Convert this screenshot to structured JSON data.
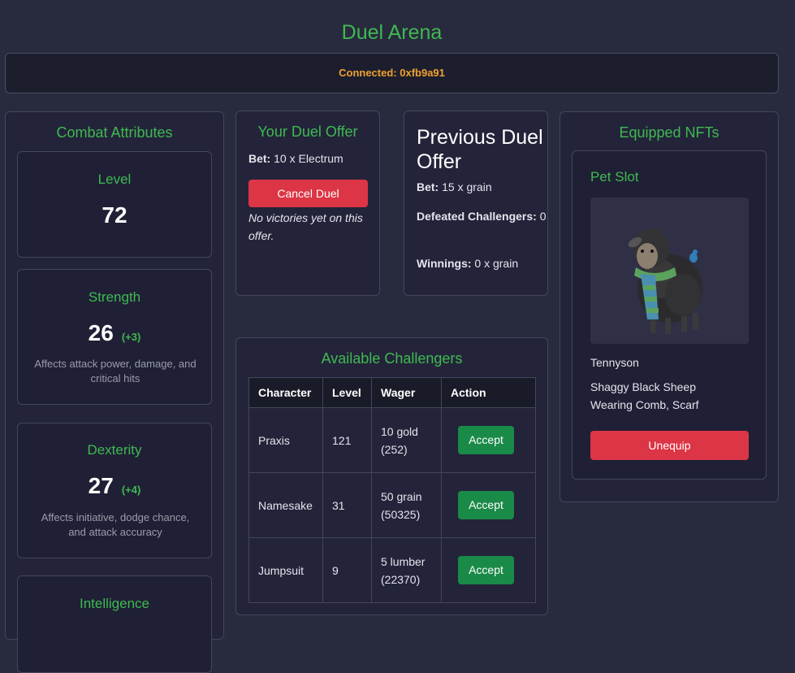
{
  "page": {
    "title": "Duel Arena"
  },
  "connection": {
    "label": "Connected:",
    "address": "0xfb9a91"
  },
  "combat": {
    "title": "Combat Attributes",
    "level": {
      "name": "Level",
      "value": "72"
    },
    "strength": {
      "name": "Strength",
      "value": "26",
      "bonus": "(+3)",
      "desc": "Affects attack power, damage, and critical hits"
    },
    "dexterity": {
      "name": "Dexterity",
      "value": "27",
      "bonus": "(+4)",
      "desc": "Affects initiative, dodge chance, and attack accuracy"
    },
    "intelligence": {
      "name": "Intelligence"
    }
  },
  "offer": {
    "title": "Your Duel Offer",
    "bet_label": "Bet:",
    "bet_value": "10 x Electrum",
    "cancel_label": "Cancel Duel",
    "note": "No victories yet on this offer."
  },
  "previous": {
    "title": "Previous Duel Offer",
    "bet_label": "Bet:",
    "bet_value": "15 x grain",
    "defeated_label": "Defeated Challengers:",
    "defeated_value": "0",
    "winnings_label": "Winnings:",
    "winnings_value": "0 x grain"
  },
  "challengers": {
    "title": "Available Challengers",
    "columns": [
      "Character",
      "Level",
      "Wager",
      "Action"
    ],
    "rows": [
      {
        "character": "Praxis",
        "level": "121",
        "wager": "10 gold",
        "wager_sub": "(252)",
        "action": "Accept"
      },
      {
        "character": "Namesake",
        "level": "31",
        "wager": "50 grain",
        "wager_sub": "(50325)",
        "action": "Accept"
      },
      {
        "character": "Jumpsuit",
        "level": "9",
        "wager": "5 lumber",
        "wager_sub": "(22370)",
        "action": "Accept"
      }
    ]
  },
  "nfts": {
    "title": "Equipped NFTs",
    "slot": "Pet Slot",
    "pet_name": "Tennyson",
    "pet_desc": "Shaggy Black Sheep Wearing Comb, Scarf",
    "unequip_label": "Unequip"
  }
}
